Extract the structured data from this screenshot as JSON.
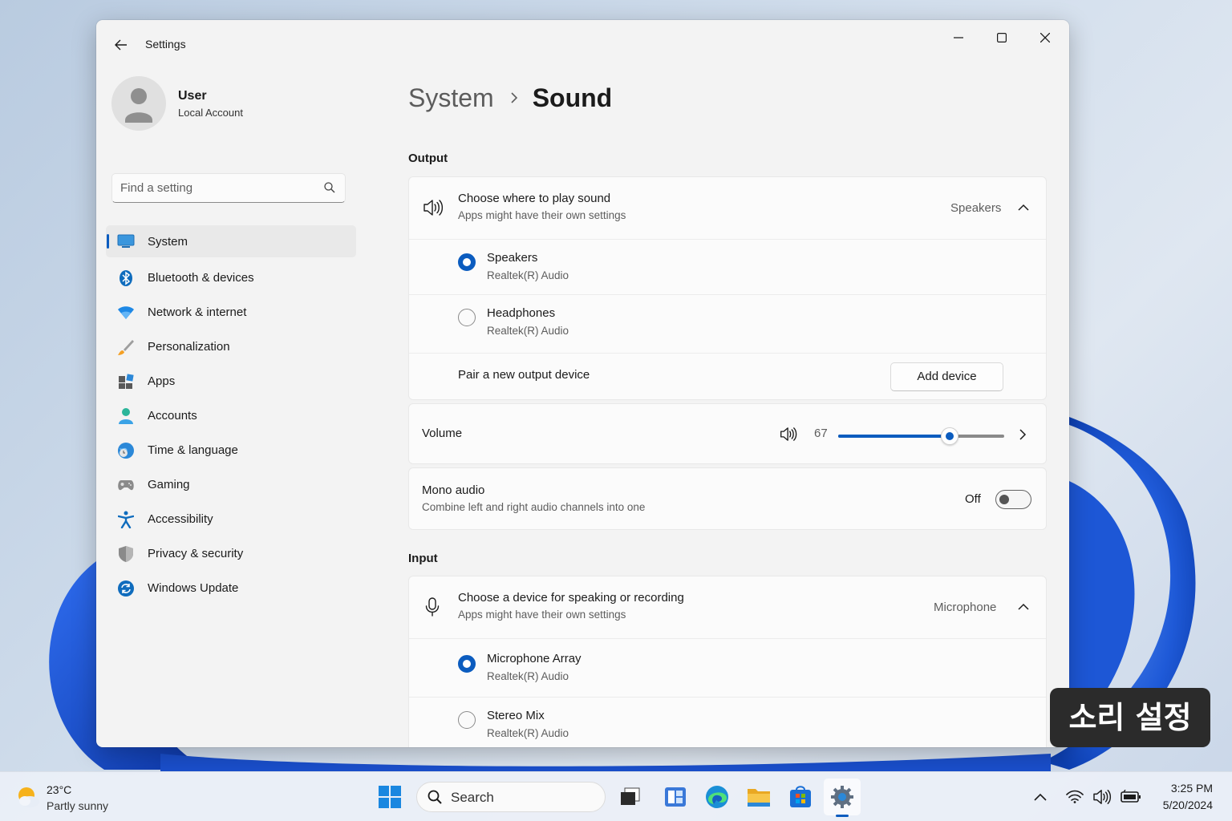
{
  "app": {
    "title": "Settings",
    "controls": [
      "minimize-icon",
      "maximize-icon",
      "close-icon"
    ]
  },
  "user": {
    "name": "User",
    "account_type": "Local Account"
  },
  "search": {
    "placeholder": "Find a setting",
    "value": ""
  },
  "sidebar": {
    "selected": "System",
    "items": [
      {
        "label": "System",
        "icon": "system-icon"
      },
      {
        "label": "Bluetooth & devices",
        "icon": "bluetooth-icon"
      },
      {
        "label": "Network & internet",
        "icon": "wifi-icon"
      },
      {
        "label": "Personalization",
        "icon": "brush-icon"
      },
      {
        "label": "Apps",
        "icon": "apps-icon"
      },
      {
        "label": "Accounts",
        "icon": "accounts-icon"
      },
      {
        "label": "Time & language",
        "icon": "globe-clock-icon"
      },
      {
        "label": "Gaming",
        "icon": "gamepad-icon"
      },
      {
        "label": "Accessibility",
        "icon": "accessibility-icon"
      },
      {
        "label": "Privacy & security",
        "icon": "shield-icon"
      },
      {
        "label": "Windows Update",
        "icon": "update-icon"
      }
    ]
  },
  "page": {
    "breadcrumb_parent": "System",
    "breadcrumb_current": "Sound"
  },
  "output": {
    "heading": "Output",
    "choose": {
      "title": "Choose where to play sound",
      "subtitle": "Apps might have their own settings",
      "selected": "Speakers"
    },
    "devices": [
      {
        "name": "Speakers",
        "driver": "Realtek(R) Audio",
        "selected": true
      },
      {
        "name": "Headphones",
        "driver": "Realtek(R) Audio",
        "selected": false
      }
    ],
    "pair_label": "Pair a new output device",
    "add_button": "Add device",
    "volume": {
      "label": "Volume",
      "value": "67",
      "level": 0.67
    },
    "mono": {
      "title": "Mono audio",
      "subtitle": "Combine left and right audio channels into one",
      "state": "Off"
    }
  },
  "input": {
    "heading": "Input",
    "choose": {
      "title": "Choose a device for speaking or recording",
      "subtitle": "Apps might have their own settings",
      "selected": "Microphone"
    },
    "devices": [
      {
        "name": "Microphone Array",
        "driver": "Realtek(R) Audio",
        "selected": true
      },
      {
        "name": "Stereo Mix",
        "driver": "Realtek(R) Audio",
        "selected": false
      }
    ]
  },
  "overlay_label": "소리 설정",
  "taskbar": {
    "weather": {
      "temp": "23°C",
      "desc": "Partly sunny"
    },
    "search_label": "Search",
    "apps": [
      "start-icon",
      "search-icon",
      "task-view-icon",
      "widgets-icon",
      "edge-icon",
      "file-explorer-icon",
      "store-icon",
      "settings-icon"
    ],
    "time": "3:25 PM",
    "date": "5/20/2024"
  },
  "colors": {
    "accent": "#0b5cbf",
    "window_bg": "#f3f3f3",
    "card_bg": "#fbfbfb"
  }
}
